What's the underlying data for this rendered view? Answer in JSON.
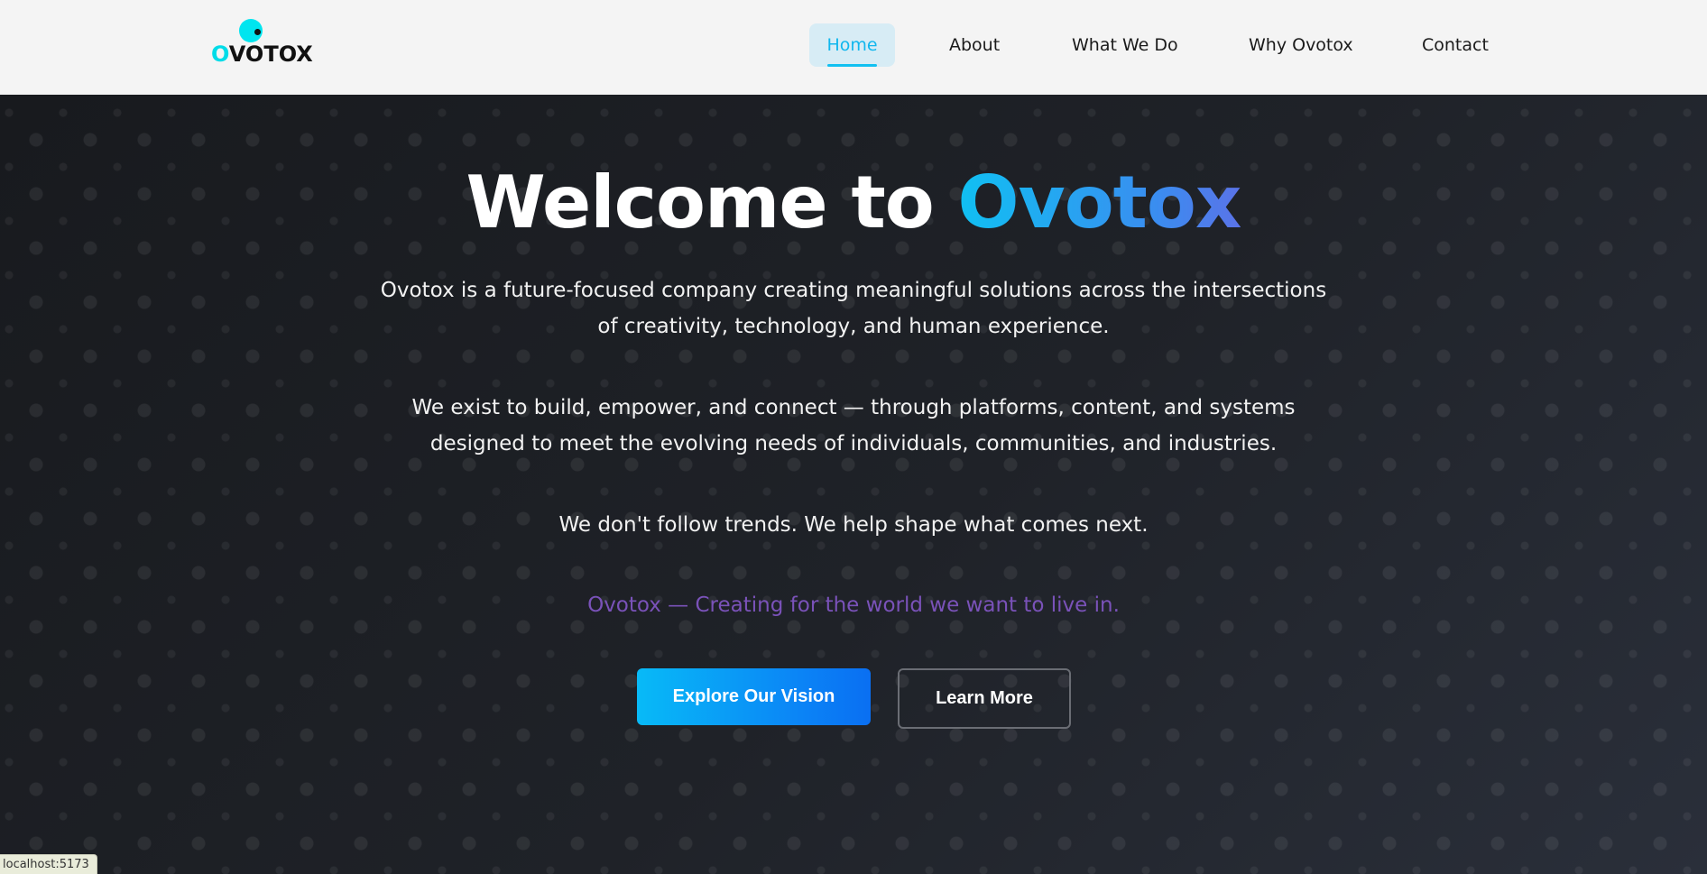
{
  "header": {
    "logo": {
      "first_letter": "O",
      "rest": "VOTOX"
    },
    "nav": [
      {
        "label": "Home",
        "active": true
      },
      {
        "label": "About",
        "active": false
      },
      {
        "label": "What We Do",
        "active": false
      },
      {
        "label": "Why Ovotox",
        "active": false
      },
      {
        "label": "Contact",
        "active": false
      }
    ]
  },
  "hero": {
    "title_prefix": "Welcome to ",
    "title_brand": "Ovotox",
    "paragraph_1_line_1": "Ovotox is a future-focused company creating meaningful solutions across the intersections",
    "paragraph_1_line_2": "of creativity, technology, and human experience.",
    "paragraph_2_line_1": "We exist to build, empower, and connect — through platforms, content, and systems",
    "paragraph_2_line_2": "designed to meet the evolving needs of individuals, communities, and industries.",
    "paragraph_3": "We don't follow trends. We help shape what comes next.",
    "tagline": "Ovotox — Creating for the world we want to live in.",
    "primary_button": "Explore Our Vision",
    "secondary_button": "Learn More"
  },
  "status_bar": {
    "url": "localhost:5173"
  },
  "colors": {
    "accent": "#11b7ee",
    "brand_gradient_start": "#10c0f2",
    "brand_gradient_end": "#5a73e8",
    "tagline": "#7a52b9",
    "hero_background": "#1f2228"
  }
}
